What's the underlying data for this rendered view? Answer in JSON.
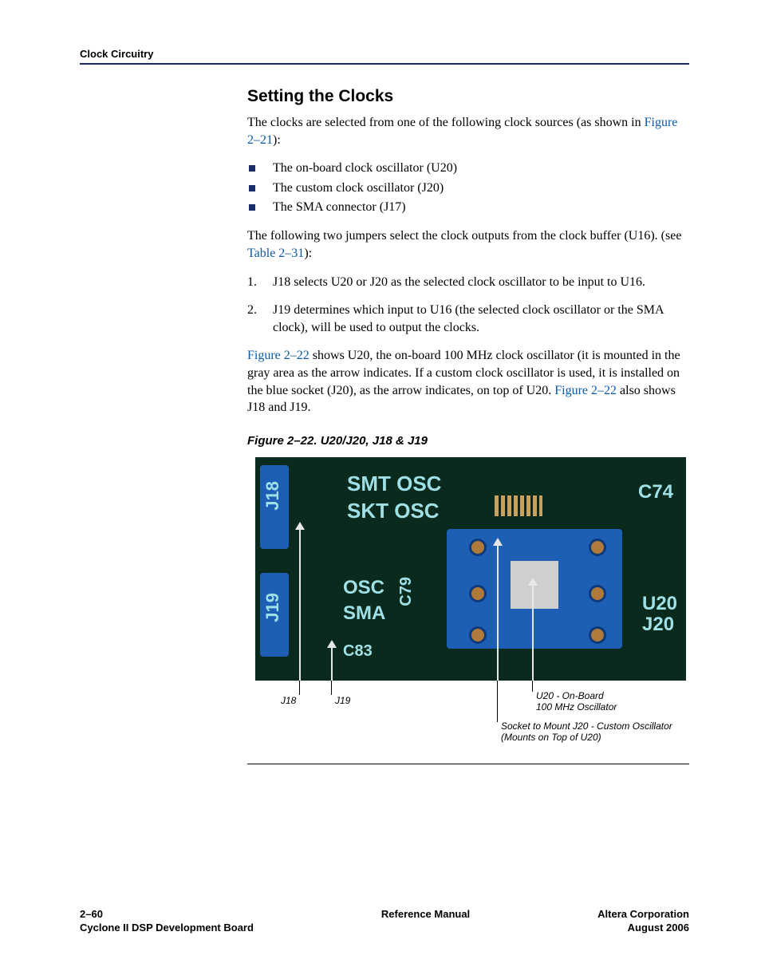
{
  "header": {
    "section": "Clock Circuitry"
  },
  "section_title": "Setting the Clocks",
  "intro_a": "The clocks are selected from one of the following clock sources (as shown in ",
  "intro_link": "Figure 2–21",
  "intro_b": "):",
  "bullets": [
    "The on-board clock oscillator (U20)",
    "The custom clock oscillator (J20)",
    "The SMA connector (J17)"
  ],
  "jumper_a": "The following two jumpers select the clock outputs from the clock buffer (U16). (see ",
  "jumper_link": "Table 2–31",
  "jumper_b": "):",
  "numbered": [
    "J18 selects U20 or J20 as the selected clock oscillator to be input to U16.",
    "J19 determines which input to U16 (the selected clock oscillator or the SMA clock), will be used to output the clocks."
  ],
  "para2_a": "Figure 2–22",
  "para2_b": " shows U20, the on-board 100 MHz clock oscillator (it is mounted in the gray area as the arrow indicates. If a custom clock oscillator is used, it is installed on the blue socket (J20), as the arrow indicates, on top of U20. ",
  "para2_c": "Figure 2–22",
  "para2_d": " also shows J18 and J19.",
  "figcap": "Figure 2–22. U20/J20, J18 & J19",
  "silk": {
    "smt_osc": "SMT  OSC",
    "skt_osc": "SKT  OSC",
    "osc": "OSC",
    "sma": "SMA",
    "c74": "C74",
    "c79": "C79",
    "c83": "C83",
    "u20": "U20",
    "j20": "J20",
    "j18": "J18",
    "j19": "J19"
  },
  "callouts": {
    "j18": "J18",
    "j19": "J19",
    "u20_a": "U20 - On-Board",
    "u20_b": "100 MHz Oscillator",
    "sock_a": "Socket to Mount J20 - Custom Oscillator",
    "sock_b": "(Mounts on Top of U20)"
  },
  "footer": {
    "page": "2–60",
    "product": "Cyclone II DSP Development Board",
    "center": "Reference Manual",
    "company": "Altera Corporation",
    "date": "August 2006"
  }
}
